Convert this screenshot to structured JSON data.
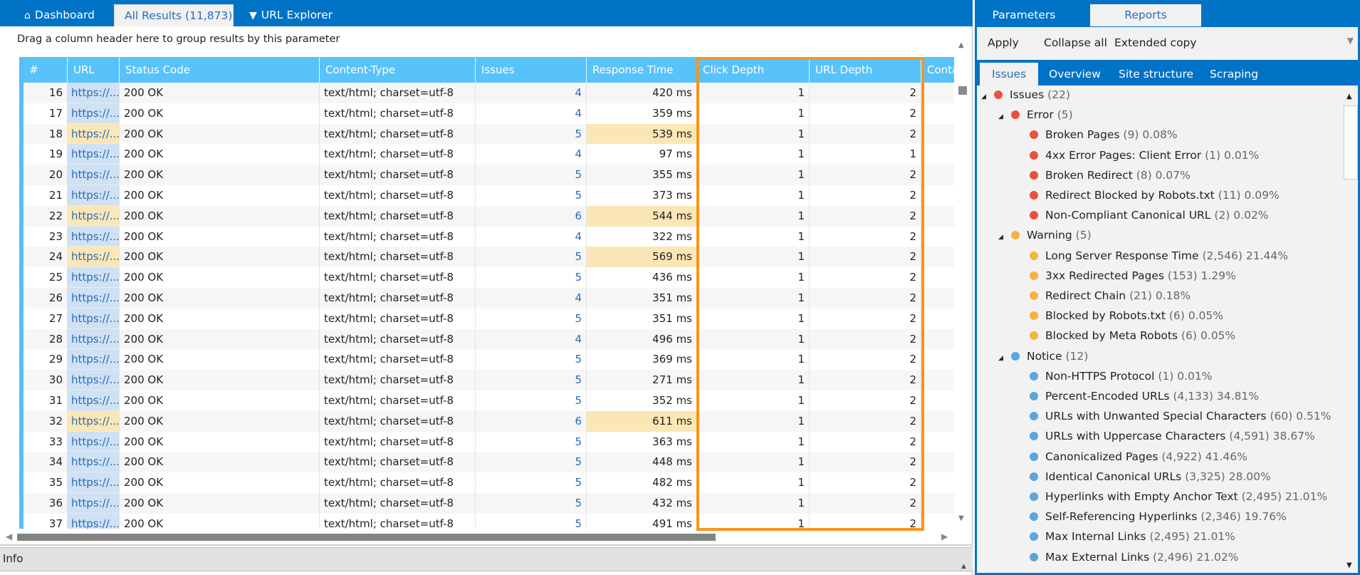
{
  "left_tabs": [
    {
      "label": "Dashboard",
      "icon": "home-icon",
      "glyph": "⌂"
    },
    {
      "label": "All Results (11,873)"
    },
    {
      "label": "URL Explorer",
      "icon": "filter-icon",
      "glyph": "▼"
    }
  ],
  "group_hint": "Drag a column header here to group results by this parameter",
  "columns": [
    "#",
    "URL",
    "Status Code",
    "Content-Type",
    "Issues",
    "Response Time",
    "Click Depth",
    "URL Depth",
    "Conta"
  ],
  "rows": [
    {
      "n": "16",
      "url": "https://...",
      "status": "200 OK",
      "ctype": "text/html; charset=utf-8",
      "issues": "4",
      "rt": "420 ms",
      "click": "1",
      "depth": "2",
      "warn": false
    },
    {
      "n": "17",
      "url": "https://...",
      "status": "200 OK",
      "ctype": "text/html; charset=utf-8",
      "issues": "4",
      "rt": "359 ms",
      "click": "1",
      "depth": "2",
      "warn": false
    },
    {
      "n": "18",
      "url": "https://...",
      "status": "200 OK",
      "ctype": "text/html; charset=utf-8",
      "issues": "5",
      "rt": "539 ms",
      "click": "1",
      "depth": "2",
      "warn": true
    },
    {
      "n": "19",
      "url": "https://...",
      "status": "200 OK",
      "ctype": "text/html; charset=utf-8",
      "issues": "4",
      "rt": "97 ms",
      "click": "1",
      "depth": "1",
      "warn": false
    },
    {
      "n": "20",
      "url": "https://...",
      "status": "200 OK",
      "ctype": "text/html; charset=utf-8",
      "issues": "5",
      "rt": "355 ms",
      "click": "1",
      "depth": "2",
      "warn": false
    },
    {
      "n": "21",
      "url": "https://...",
      "status": "200 OK",
      "ctype": "text/html; charset=utf-8",
      "issues": "5",
      "rt": "373 ms",
      "click": "1",
      "depth": "2",
      "warn": false
    },
    {
      "n": "22",
      "url": "https://...",
      "status": "200 OK",
      "ctype": "text/html; charset=utf-8",
      "issues": "6",
      "rt": "544 ms",
      "click": "1",
      "depth": "2",
      "warn": true
    },
    {
      "n": "23",
      "url": "https://...",
      "status": "200 OK",
      "ctype": "text/html; charset=utf-8",
      "issues": "4",
      "rt": "322 ms",
      "click": "1",
      "depth": "2",
      "warn": false
    },
    {
      "n": "24",
      "url": "https://...",
      "status": "200 OK",
      "ctype": "text/html; charset=utf-8",
      "issues": "5",
      "rt": "569 ms",
      "click": "1",
      "depth": "2",
      "warn": true
    },
    {
      "n": "25",
      "url": "https://...",
      "status": "200 OK",
      "ctype": "text/html; charset=utf-8",
      "issues": "5",
      "rt": "436 ms",
      "click": "1",
      "depth": "2",
      "warn": false
    },
    {
      "n": "26",
      "url": "https://...",
      "status": "200 OK",
      "ctype": "text/html; charset=utf-8",
      "issues": "4",
      "rt": "351 ms",
      "click": "1",
      "depth": "2",
      "warn": false
    },
    {
      "n": "27",
      "url": "https://...",
      "status": "200 OK",
      "ctype": "text/html; charset=utf-8",
      "issues": "5",
      "rt": "351 ms",
      "click": "1",
      "depth": "2",
      "warn": false
    },
    {
      "n": "28",
      "url": "https://...",
      "status": "200 OK",
      "ctype": "text/html; charset=utf-8",
      "issues": "4",
      "rt": "496 ms",
      "click": "1",
      "depth": "2",
      "warn": false
    },
    {
      "n": "29",
      "url": "https://...",
      "status": "200 OK",
      "ctype": "text/html; charset=utf-8",
      "issues": "5",
      "rt": "369 ms",
      "click": "1",
      "depth": "2",
      "warn": false
    },
    {
      "n": "30",
      "url": "https://...",
      "status": "200 OK",
      "ctype": "text/html; charset=utf-8",
      "issues": "5",
      "rt": "271 ms",
      "click": "1",
      "depth": "2",
      "warn": false
    },
    {
      "n": "31",
      "url": "https://...",
      "status": "200 OK",
      "ctype": "text/html; charset=utf-8",
      "issues": "5",
      "rt": "352 ms",
      "click": "1",
      "depth": "2",
      "warn": false
    },
    {
      "n": "32",
      "url": "https://...",
      "status": "200 OK",
      "ctype": "text/html; charset=utf-8",
      "issues": "6",
      "rt": "611 ms",
      "click": "1",
      "depth": "2",
      "warn": true
    },
    {
      "n": "33",
      "url": "https://...",
      "status": "200 OK",
      "ctype": "text/html; charset=utf-8",
      "issues": "5",
      "rt": "363 ms",
      "click": "1",
      "depth": "2",
      "warn": false
    },
    {
      "n": "34",
      "url": "https://...",
      "status": "200 OK",
      "ctype": "text/html; charset=utf-8",
      "issues": "5",
      "rt": "448 ms",
      "click": "1",
      "depth": "2",
      "warn": false
    },
    {
      "n": "35",
      "url": "https://...",
      "status": "200 OK",
      "ctype": "text/html; charset=utf-8",
      "issues": "5",
      "rt": "482 ms",
      "click": "1",
      "depth": "2",
      "warn": false
    },
    {
      "n": "36",
      "url": "https://...",
      "status": "200 OK",
      "ctype": "text/html; charset=utf-8",
      "issues": "5",
      "rt": "432 ms",
      "click": "1",
      "depth": "2",
      "warn": false
    },
    {
      "n": "37",
      "url": "https://...",
      "status": "200 OK",
      "ctype": "text/html; charset=utf-8",
      "issues": "5",
      "rt": "491 ms",
      "click": "1",
      "depth": "2",
      "warn": false
    }
  ],
  "info_label": "Info",
  "right_tabs": [
    "Parameters",
    "Reports"
  ],
  "toolbar": {
    "apply": "Apply",
    "collapse": "Collapse all",
    "copy": "Extended copy"
  },
  "sub_tabs": [
    "Issues",
    "Overview",
    "Site structure",
    "Scraping"
  ],
  "colors": {
    "error": "#e8523a",
    "warning": "#f5b43e",
    "notice": "#5aa5dc",
    "accent": "#0073c6",
    "highlight": "#f7951d"
  },
  "tree": [
    {
      "level": 0,
      "type": "error",
      "label": "Issues",
      "count": "(22)",
      "pct": "",
      "expandable": true
    },
    {
      "level": 1,
      "type": "error",
      "label": "Error",
      "count": "(5)",
      "pct": "",
      "expandable": true
    },
    {
      "level": 2,
      "type": "error",
      "label": "Broken Pages",
      "count": "(9)",
      "pct": "0.08%"
    },
    {
      "level": 2,
      "type": "error",
      "label": "4xx Error Pages: Client Error",
      "count": "(1)",
      "pct": "0.01%"
    },
    {
      "level": 2,
      "type": "error",
      "label": "Broken Redirect",
      "count": "(8)",
      "pct": "0.07%"
    },
    {
      "level": 2,
      "type": "error",
      "label": "Redirect Blocked by Robots.txt",
      "count": "(11)",
      "pct": "0.09%"
    },
    {
      "level": 2,
      "type": "error",
      "label": "Non-Compliant Canonical URL",
      "count": "(2)",
      "pct": "0.02%"
    },
    {
      "level": 1,
      "type": "warning",
      "label": "Warning",
      "count": "(5)",
      "pct": "",
      "expandable": true
    },
    {
      "level": 2,
      "type": "warning",
      "label": "Long Server Response Time",
      "count": "(2,546)",
      "pct": "21.44%"
    },
    {
      "level": 2,
      "type": "warning",
      "label": "3xx Redirected Pages",
      "count": "(153)",
      "pct": "1.29%"
    },
    {
      "level": 2,
      "type": "warning",
      "label": "Redirect Chain",
      "count": "(21)",
      "pct": "0.18%"
    },
    {
      "level": 2,
      "type": "warning",
      "label": "Blocked by Robots.txt",
      "count": "(6)",
      "pct": "0.05%"
    },
    {
      "level": 2,
      "type": "warning",
      "label": "Blocked by Meta Robots",
      "count": "(6)",
      "pct": "0.05%"
    },
    {
      "level": 1,
      "type": "notice",
      "label": "Notice",
      "count": "(12)",
      "pct": "",
      "expandable": true
    },
    {
      "level": 2,
      "type": "notice",
      "label": "Non-HTTPS Protocol",
      "count": "(1)",
      "pct": "0.01%"
    },
    {
      "level": 2,
      "type": "notice",
      "label": "Percent-Encoded URLs",
      "count": "(4,133)",
      "pct": "34.81%"
    },
    {
      "level": 2,
      "type": "notice",
      "label": "URLs with Unwanted Special Characters",
      "count": "(60)",
      "pct": "0.51%"
    },
    {
      "level": 2,
      "type": "notice",
      "label": "URLs with Uppercase Characters",
      "count": "(4,591)",
      "pct": "38.67%"
    },
    {
      "level": 2,
      "type": "notice",
      "label": "Canonicalized Pages",
      "count": "(4,922)",
      "pct": "41.46%"
    },
    {
      "level": 2,
      "type": "notice",
      "label": "Identical Canonical URLs",
      "count": "(3,325)",
      "pct": "28.00%"
    },
    {
      "level": 2,
      "type": "notice",
      "label": "Hyperlinks with Empty Anchor Text",
      "count": "(2,495)",
      "pct": "21.01%"
    },
    {
      "level": 2,
      "type": "notice",
      "label": "Self-Referencing Hyperlinks",
      "count": "(2,346)",
      "pct": "19.76%"
    },
    {
      "level": 2,
      "type": "notice",
      "label": "Max Internal Links",
      "count": "(2,495)",
      "pct": "21.01%"
    },
    {
      "level": 2,
      "type": "notice",
      "label": "Max External Links",
      "count": "(2,496)",
      "pct": "21.02%"
    }
  ]
}
